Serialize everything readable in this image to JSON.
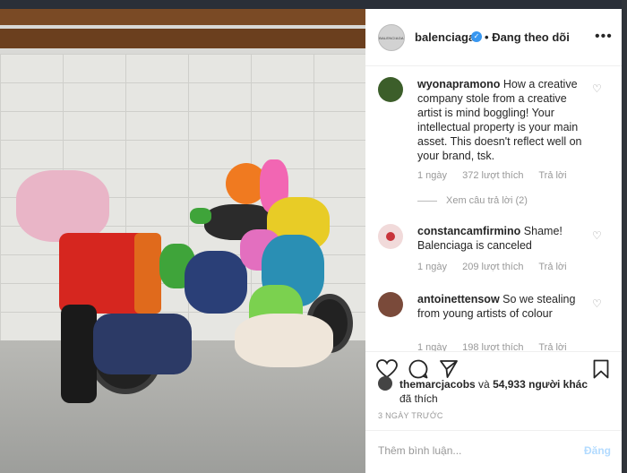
{
  "header": {
    "avatar_text": "BALENCIAGA",
    "username": "balenciaga",
    "verified_icon": "verified-badge-icon",
    "separator": "•",
    "follow_status": "Đang theo dõi",
    "more": "•••"
  },
  "comments": [
    {
      "username": "wyonapramono",
      "text": "How a creative company stole from a creative artist is mind boggling! Your intellectual property is your main asset. This doesn't reflect well on your brand, tsk.",
      "time": "1 ngày",
      "likes": "372 lượt thích",
      "reply": "Trả lời",
      "avatar_color": "#3c5e2a"
    },
    {
      "username": "constancamfirmino",
      "text": "Shame! Balenciaga is canceled",
      "time": "1 ngày",
      "likes": "209 lượt thích",
      "reply": "Trả lời",
      "avatar_color": "#c8333a"
    },
    {
      "username": "antoinettensow",
      "text": "So we stealing from young artists of colour",
      "time": "1 ngày",
      "likes": "198 lượt thích",
      "reply": "Trả lời",
      "avatar_color": "#7a4a3a"
    }
  ],
  "view_replies": "Xem câu trả lời (2)",
  "likes": {
    "first_user": "themarcjacobs",
    "conjunction": "và",
    "others": "54,933 người khác",
    "suffix": "đã thích"
  },
  "time_ago": "3 NGÀY TRƯỚC",
  "comment_input": {
    "placeholder": "Thêm bình luận...",
    "post_label": "Đăng"
  },
  "icons": {
    "like": "heart-icon",
    "comment": "comment-icon",
    "share": "share-icon",
    "save": "bookmark-icon"
  }
}
